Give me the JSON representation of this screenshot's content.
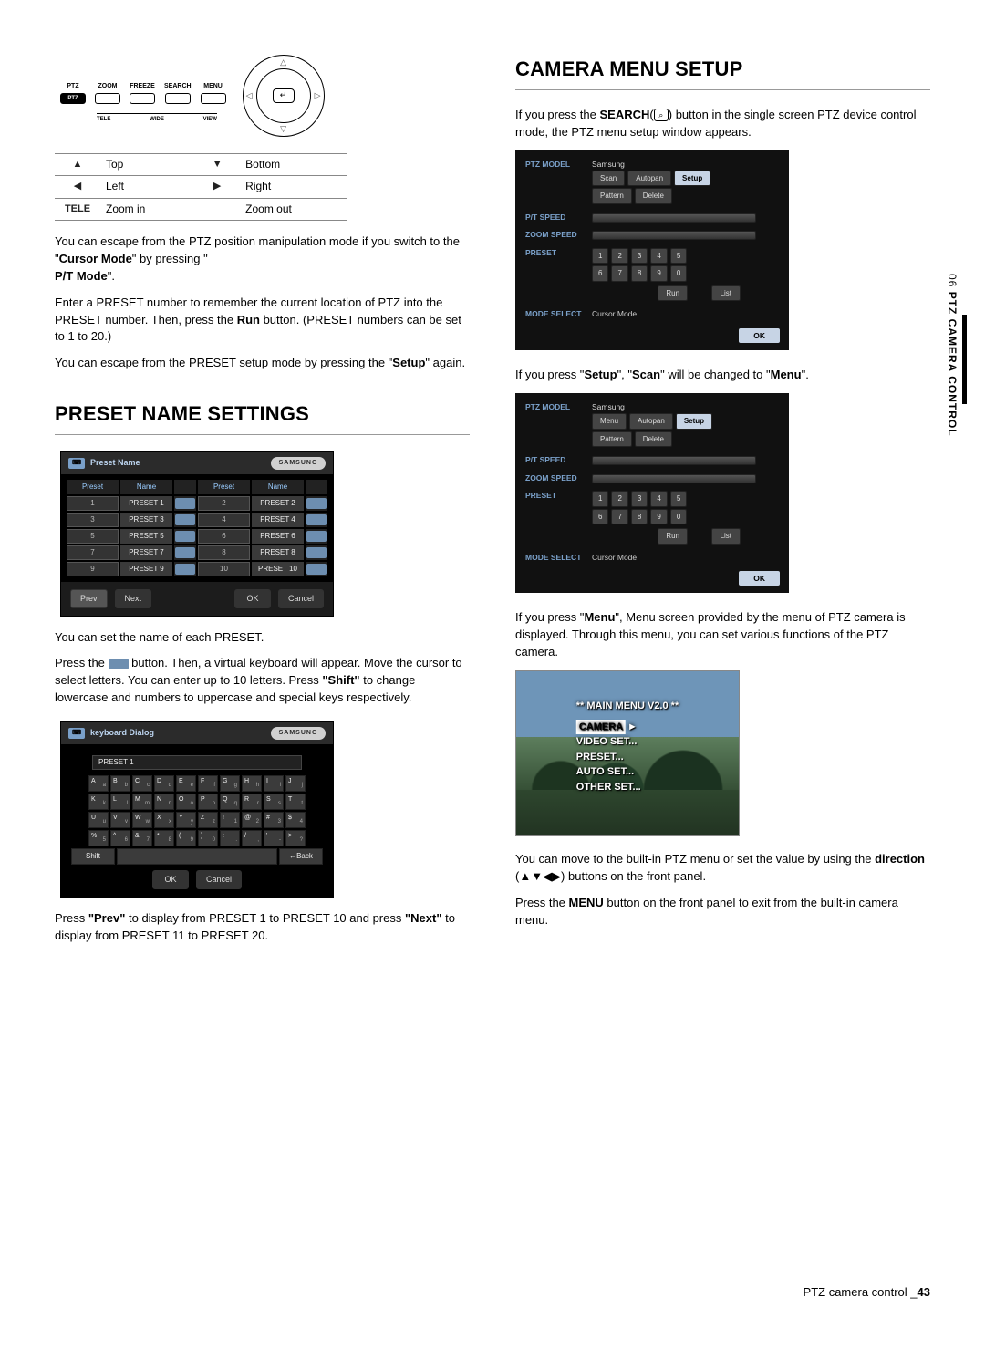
{
  "remote": {
    "buttons": [
      "PTZ",
      "ZOOM",
      "FREEZE",
      "SEARCH",
      "MENU"
    ],
    "sub": [
      "TELE",
      "WIDE",
      "VIEW"
    ],
    "dpad_center": "↵"
  },
  "dir_table": [
    {
      "sym": "▲",
      "label": "Top",
      "sym2": "▼",
      "label2": "Bottom"
    },
    {
      "sym": "◀",
      "label": "Left",
      "sym2": "▶",
      "label2": "Right"
    },
    {
      "sym": "TELE",
      "sym_bold": true,
      "label": "Zoom in",
      "sym2": "",
      "label2": "Zoom out"
    }
  ],
  "left": {
    "p1a": "You can escape from the PTZ position manipulation mode if you switch to the \"",
    "p1b": "Cursor Mode",
    "p1c": "\" by pressing \"",
    "p1d": "P/T Mode",
    "p1e": "\".",
    "p2a": "Enter a PRESET number to remember the current location of PTZ into the PRESET number. Then, press the ",
    "p2b": "Run",
    "p2c": " button. (PRESET numbers can be set to 1 to 20.)",
    "p3a": "You can escape from the PRESET setup mode by pressing the \"",
    "p3b": "Setup",
    "p3c": "\" again.",
    "h_preset": "PRESET NAME SETTINGS",
    "preset_dialog": {
      "title": "Preset Name",
      "logo": "SAMSUNG",
      "headers": [
        "Preset",
        "Name",
        "Preset",
        "Name"
      ],
      "rows": [
        [
          "1",
          "PRESET 1",
          "2",
          "PRESET 2"
        ],
        [
          "3",
          "PRESET 3",
          "4",
          "PRESET 4"
        ],
        [
          "5",
          "PRESET 5",
          "6",
          "PRESET 6"
        ],
        [
          "7",
          "PRESET 7",
          "8",
          "PRESET 8"
        ],
        [
          "9",
          "PRESET 9",
          "10",
          "PRESET 10"
        ]
      ],
      "prev": "Prev",
      "next": "Next",
      "ok": "OK",
      "cancel": "Cancel"
    },
    "p4a": "You can set the name of each PRESET.",
    "p4b": "Press the ",
    "p4c": " button. Then, a virtual keyboard will appear. Move the cursor to select letters. You can enter up to 10 letters. Press ",
    "p4d": "\"Shift\"",
    "p4e": " to change lowercase and numbers to uppercase and special keys respectively.",
    "keyboard": {
      "title": "keyboard Dialog",
      "logo": "SAMSUNG",
      "field": "PRESET 1",
      "row1": [
        [
          "A",
          "a"
        ],
        [
          "B",
          "b"
        ],
        [
          "C",
          "c"
        ],
        [
          "D",
          "d"
        ],
        [
          "E",
          "e"
        ],
        [
          "F",
          "f"
        ],
        [
          "G",
          "g"
        ],
        [
          "H",
          "h"
        ],
        [
          "I",
          "i"
        ],
        [
          "J",
          "j"
        ]
      ],
      "row2": [
        [
          "K",
          "k"
        ],
        [
          "L",
          "l"
        ],
        [
          "M",
          "m"
        ],
        [
          "N",
          "n"
        ],
        [
          "O",
          "o"
        ],
        [
          "P",
          "p"
        ],
        [
          "Q",
          "q"
        ],
        [
          "R",
          "r"
        ],
        [
          "S",
          "s"
        ],
        [
          "T",
          "t"
        ]
      ],
      "row3": [
        [
          "U",
          "u"
        ],
        [
          "V",
          "v"
        ],
        [
          "W",
          "w"
        ],
        [
          "X",
          "x"
        ],
        [
          "Y",
          "y"
        ],
        [
          "Z",
          "z"
        ],
        [
          "!",
          "1"
        ],
        [
          "@",
          "2"
        ],
        [
          "#",
          "3"
        ],
        [
          "$",
          "4"
        ]
      ],
      "row4": [
        [
          "%",
          "5"
        ],
        [
          "^",
          "6"
        ],
        [
          "&",
          "7"
        ],
        [
          "*",
          "8"
        ],
        [
          "(",
          "9"
        ],
        [
          ")",
          "0"
        ],
        [
          ":",
          "."
        ],
        [
          "/",
          ","
        ],
        [
          "'",
          "-"
        ],
        [
          ">",
          "?"
        ]
      ],
      "shift": "Shift",
      "back": "←Back",
      "ok": "OK",
      "cancel": "Cancel"
    },
    "p5a": "Press ",
    "p5b": "\"Prev\"",
    "p5c": " to display from PRESET 1 to PRESET 10 and press ",
    "p5d": "\"Next\"",
    "p5e": " to display from PRESET 11 to PRESET 20."
  },
  "right": {
    "h_camera": "CAMERA MENU SETUP",
    "p1a": "If you press the ",
    "p1b": "SEARCH",
    "p1c": " button in the single screen PTZ device control mode, the PTZ menu setup window appears.",
    "search_icon": "⌕",
    "ptz1": {
      "model_lbl": "PTZ MODEL",
      "model": "Samsung",
      "chips_a": [
        "Scan",
        "Autopan",
        "Setup"
      ],
      "chips_b": [
        "Pattern",
        "Delete"
      ],
      "pt_lbl": "P/T SPEED",
      "zoom_lbl": "ZOOM SPEED",
      "preset_lbl": "PRESET",
      "nums1": [
        "1",
        "2",
        "3",
        "4",
        "5"
      ],
      "nums2": [
        "6",
        "7",
        "8",
        "9",
        "0"
      ],
      "run": "Run",
      "list": "List",
      "mode_lbl": "MODE SELECT",
      "mode_val": "Cursor Mode",
      "ok": "OK",
      "setup_sel": "Setup"
    },
    "p2a": "If you press \"",
    "p2b": "Setup",
    "p2c": "\", \"",
    "p2d": "Scan",
    "p2e": "\" will be changed to \"",
    "p2f": "Menu",
    "p2g": "\".",
    "ptz2_chips_a": [
      "Menu",
      "Autopan",
      "Setup"
    ],
    "p3a": "If you press \"",
    "p3b": "Menu",
    "p3c": "\", Menu screen provided by the menu of PTZ camera is displayed. Through this menu, you can set various functions of the PTZ camera.",
    "camera_menu": {
      "title": "** MAIN MENU V2.0 **",
      "items": [
        "CAMERA",
        "VIDEO SET...",
        "PRESET...",
        "AUTO SET...",
        "OTHER SET..."
      ],
      "highlight": 0,
      "arrow": "►"
    },
    "p4a": "You can move to the built-in PTZ menu or set the value by using the ",
    "p4b": "direction",
    "p4c": " (▲▼◀▶) buttons on the front panel.",
    "p5a": "Press the ",
    "p5b": "MENU",
    "p5c": " button on the front panel to exit from the built-in camera menu."
  },
  "side_label_num": "06 ",
  "side_label": "PTZ CAMERA CONTROL",
  "footer": {
    "section": "PTZ camera control _",
    "page": "43"
  }
}
